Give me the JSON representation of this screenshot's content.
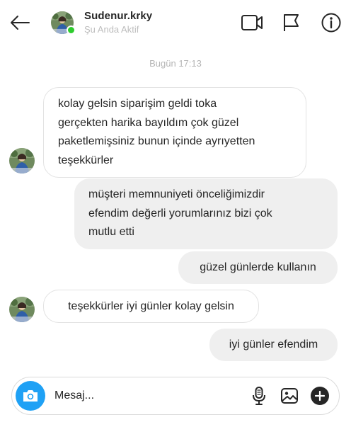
{
  "header": {
    "username": "Sudenur.krky",
    "status": "Şu Anda Aktif"
  },
  "chat": {
    "timestamp": "Bugün 17:13",
    "messages": [
      {
        "side": "incoming",
        "lines": [
          "kolay gelsin siparişim geldi toka",
          "gerçekten harika bayıldım çok güzel",
          "paketlemişsiniz bunun içinde ayrıyetten",
          "teşekkürler"
        ]
      },
      {
        "side": "outgoing",
        "lines": [
          "müşteri memnuniyeti önceliğimizdir",
          "efendim değerli yorumlarınız bizi çok",
          "mutlu etti"
        ]
      },
      {
        "side": "outgoing",
        "lines": [
          "güzel günlerde kullanın"
        ]
      },
      {
        "side": "incoming",
        "lines": [
          "teşekkürler iyi günler kolay gelsin"
        ]
      },
      {
        "side": "outgoing",
        "lines": [
          "iyi günler efendim"
        ]
      }
    ]
  },
  "composer": {
    "placeholder": "Mesaj..."
  },
  "colors": {
    "accent": "#1fa1f5",
    "online": "#2ecc2e",
    "outgoing_bubble": "#efefef",
    "incoming_border": "#e2e2e2"
  },
  "icons": {
    "back": "arrow-left-icon",
    "video": "video-camera-icon",
    "report": "flag-icon",
    "info": "info-icon",
    "camera": "camera-icon",
    "mic": "microphone-icon",
    "gallery": "image-icon",
    "add": "plus-circle-icon"
  }
}
